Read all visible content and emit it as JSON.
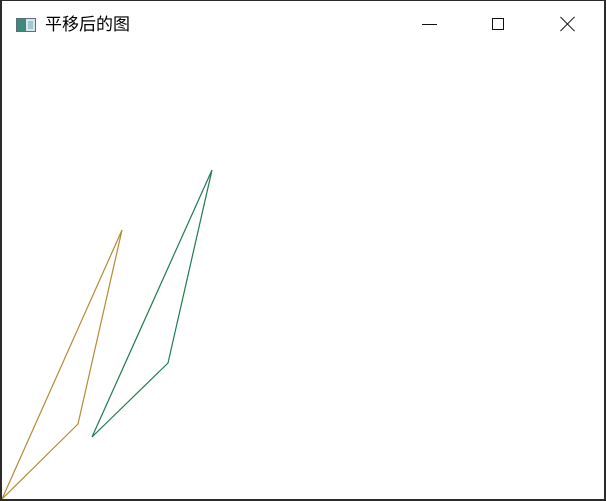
{
  "window": {
    "title": "平移后的图"
  },
  "caption_buttons": {
    "minimize_icon": "minimize-icon",
    "maximize_icon": "maximize-icon",
    "close_icon": "close-icon"
  },
  "drawing": {
    "shapes": [
      {
        "name": "original-triangle",
        "stroke": "#b58a35"
      },
      {
        "name": "translated-triangle",
        "stroke": "#1f7b50"
      }
    ]
  }
}
